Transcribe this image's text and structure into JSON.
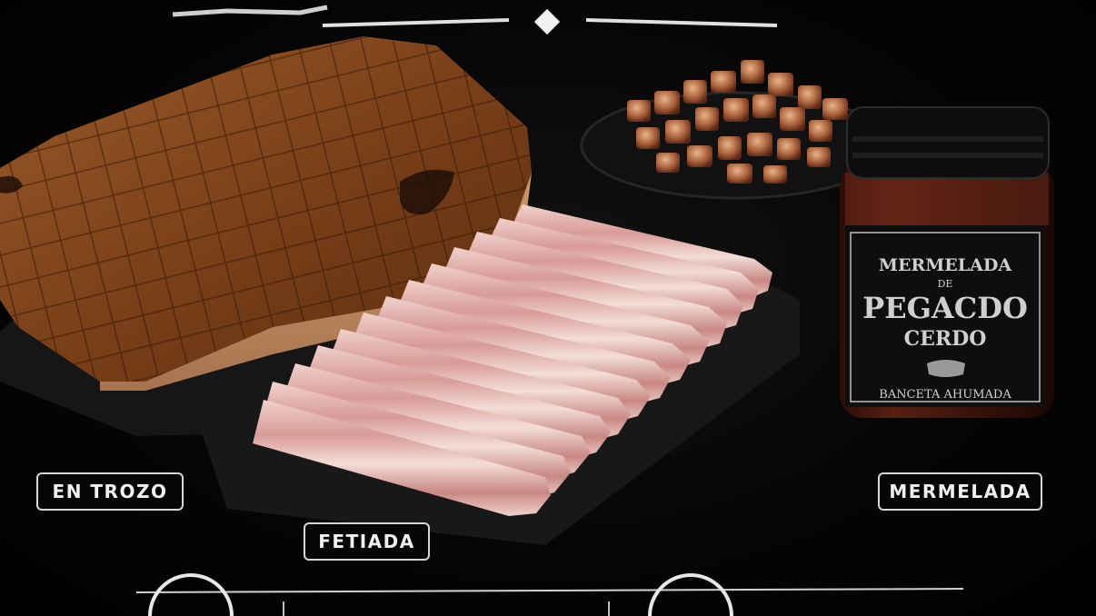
{
  "labels": {
    "en_trozo": "EN TROZO",
    "fetiada": "FETIADA",
    "mermelada": "MERMELADA"
  },
  "jar": {
    "line1": "MERMELADA",
    "line2": "DE",
    "line3": "PEGACDO",
    "line4": "CERDO",
    "line5": "BANCETA AHUMADA"
  },
  "colors": {
    "background": "#000000",
    "pill_border": "#d7d7d7",
    "pill_text": "#f0f0f0"
  }
}
